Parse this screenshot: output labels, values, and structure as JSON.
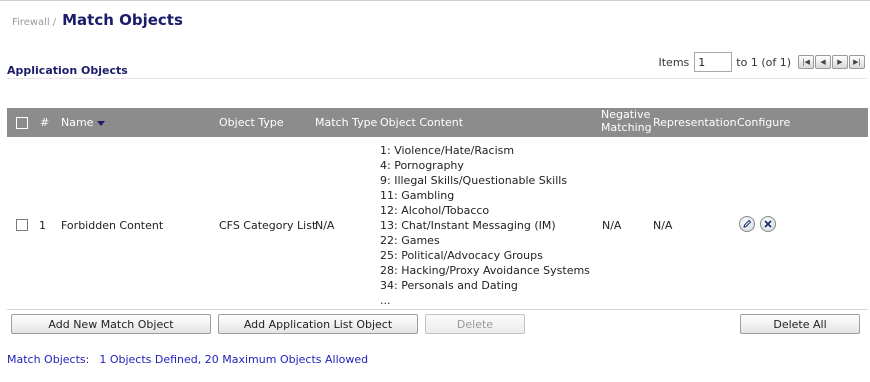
{
  "breadcrumb": {
    "parent": "Firewall",
    "separator": "/",
    "title": "Match Objects"
  },
  "section": {
    "title": "Application Objects"
  },
  "pager": {
    "items_label": "Items",
    "items_value": "1",
    "range_text": "to 1 (of 1)"
  },
  "table": {
    "headers": {
      "num": "#",
      "name": "Name",
      "object_type": "Object Type",
      "match_type": "Match Type",
      "object_content": "Object Content",
      "negative_1": "Negative",
      "negative_2": "Matching",
      "representation": "Representation",
      "configure": "Configure"
    },
    "rows": [
      {
        "num": "1",
        "name": "Forbidden Content",
        "object_type": "CFS Category List",
        "match_type": "N/A",
        "content": [
          "1: Violence/Hate/Racism",
          "4: Pornography",
          "9: Illegal Skills/Questionable Skills",
          "11: Gambling",
          "12: Alcohol/Tobacco",
          "13: Chat/Instant Messaging (IM)",
          "22: Games",
          "25: Political/Advocacy Groups",
          "28: Hacking/Proxy Avoidance Systems",
          "34: Personals and Dating",
          "..."
        ],
        "negative": "N/A",
        "representation": "N/A"
      }
    ]
  },
  "buttons": {
    "add_match_object": "Add New Match Object",
    "add_app_list": "Add Application List Object",
    "delete": "Delete",
    "delete_all": "Delete All"
  },
  "status": {
    "label": "Match Objects:",
    "text": "1 Objects Defined, 20 Maximum Objects Allowed"
  },
  "colors": {
    "header_bg": "#8c8c8c",
    "title": "#1c1c6a",
    "status": "#2222bb"
  }
}
